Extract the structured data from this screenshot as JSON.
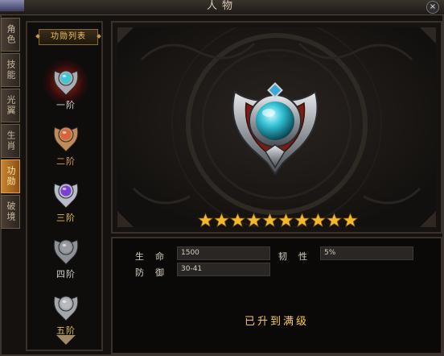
{
  "window": {
    "title": "人物",
    "close": "×"
  },
  "tabs": [
    {
      "label": "角色",
      "active": false
    },
    {
      "label": "技能",
      "active": false
    },
    {
      "label": "光翼",
      "active": false
    },
    {
      "label": "生肖",
      "active": false
    },
    {
      "label": "功勋",
      "active": true
    },
    {
      "label": "破境",
      "active": false
    }
  ],
  "medal_list": {
    "header": "功勋列表",
    "items": [
      {
        "label": "一阶",
        "gem": "#3fc6d6",
        "frame": "#a9adb3",
        "label_color": "#d8d2c8",
        "selected": true
      },
      {
        "label": "二阶",
        "gem": "#d9643a",
        "frame": "#c08a5a",
        "label_color": "#d49a5e",
        "selected": false
      },
      {
        "label": "三阶",
        "gem": "#7b3fd6",
        "frame": "#b8bcc6",
        "label_color": "#e0bf4a",
        "selected": false
      },
      {
        "label": "四阶",
        "gem": "#9a9aa0",
        "frame": "#8d9096",
        "label_color": "#cfcfcf",
        "selected": false
      },
      {
        "label": "五阶",
        "gem": "#b7b9bd",
        "frame": "#a3a6ab",
        "label_color": "#e0bf4a",
        "selected": false
      }
    ]
  },
  "selected_medal": {
    "gem": "#33c0d4",
    "frame": "#b4b8be",
    "accent": "#8a1e14",
    "stars": 10,
    "max_stars": 10
  },
  "stats": {
    "hp_label": "生命",
    "hp_value": "1500",
    "tough_label": "韧性",
    "tough_value": "5%",
    "def_label": "防御",
    "def_value": "30-41"
  },
  "status": "已升到满级",
  "colors": {
    "star": "#f3b92a",
    "highlight": "#f5cd55",
    "active_tab": "#c98530"
  }
}
